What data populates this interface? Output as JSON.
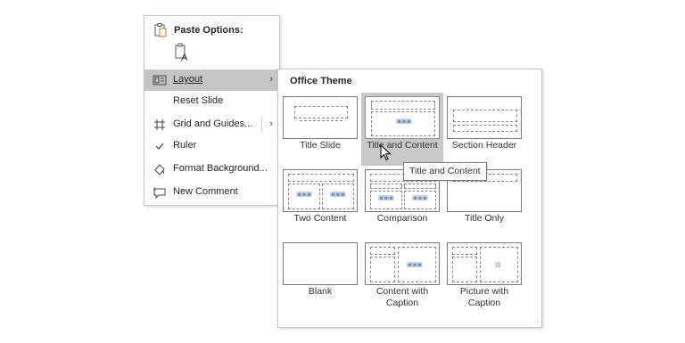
{
  "context_menu": {
    "paste_options_label": "Paste Options:",
    "items": [
      {
        "label": "Layout",
        "icon": "layout-icon",
        "has_submenu": true,
        "highlighted": true
      },
      {
        "label": "Reset Slide",
        "icon": "",
        "has_submenu": false
      },
      {
        "label": "Grid and Guides...",
        "icon": "grid-icon",
        "has_submenu": true
      },
      {
        "label": "Ruler",
        "icon": "check-icon",
        "has_submenu": false
      },
      {
        "label": "Format Background...",
        "icon": "format-background-icon",
        "has_submenu": false
      },
      {
        "label": "New Comment",
        "icon": "comment-icon",
        "has_submenu": false
      }
    ]
  },
  "layout_panel": {
    "title": "Office Theme",
    "layouts": [
      {
        "label": "Title Slide",
        "selected": false
      },
      {
        "label": "Title and Content",
        "selected": true
      },
      {
        "label": "Section Header",
        "selected": false
      },
      {
        "label": "Two Content",
        "selected": false
      },
      {
        "label": "Comparison",
        "selected": false
      },
      {
        "label": "Title Only",
        "selected": false
      },
      {
        "label": "Blank",
        "selected": false
      },
      {
        "label": "Content with Caption",
        "selected": false
      },
      {
        "label": "Picture with Caption",
        "selected": false
      }
    ]
  },
  "tooltip": {
    "text": "Title and Content"
  }
}
